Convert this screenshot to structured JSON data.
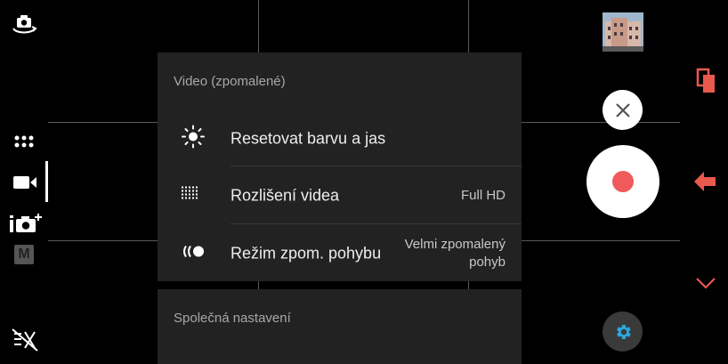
{
  "colors": {
    "accent": "#e8594e",
    "record": "#f05a5a",
    "settings_icon": "#2aa7e0"
  },
  "left_toolbar": {
    "icons": [
      "switch-camera-icon",
      "more-modes-icon",
      "video-mode-icon",
      "photo-plus-icon",
      "manual-mode-icon",
      "flash-off-icon"
    ],
    "manual_label": "M"
  },
  "menu": {
    "section_title": "Video (zpomalené)",
    "items": [
      {
        "icon": "brightness-icon",
        "label": "Resetovat barvu a jas",
        "value": ""
      },
      {
        "icon": "resolution-grid-icon",
        "label": "Rozlišení videa",
        "value": "Full HD"
      },
      {
        "icon": "slow-motion-icon",
        "label": "Režim zpom. pohybu",
        "value": "Velmi zpomalený pohyb"
      }
    ],
    "common_section_title": "Společná nastavení"
  },
  "right_controls": {
    "icons": [
      "gallery-thumbnail",
      "close-icon",
      "record-button",
      "settings-gear-icon"
    ]
  },
  "edge_controls": {
    "icons": [
      "copy-icon",
      "arrow-left-icon",
      "chevron-down-icon"
    ]
  }
}
